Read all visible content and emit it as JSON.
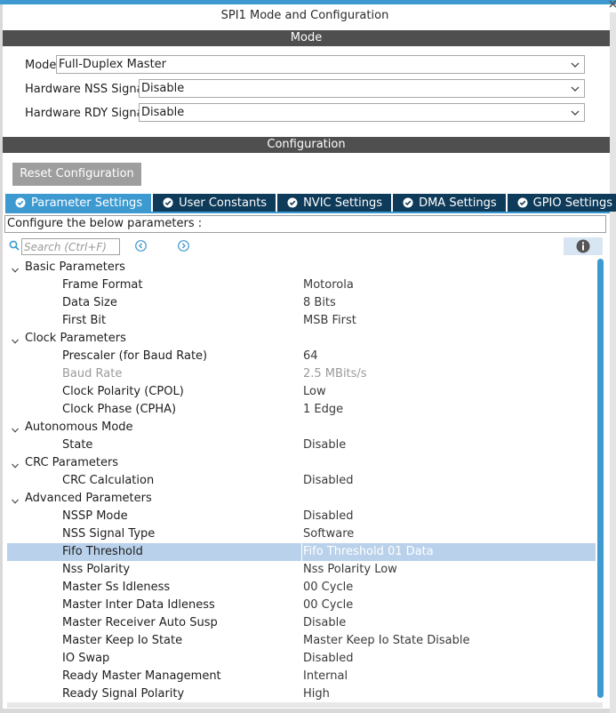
{
  "window": {
    "title": "SPI1 Mode and Configuration"
  },
  "mode_section": {
    "header": "Mode",
    "fields": [
      {
        "label": "Mode",
        "value": "Full-Duplex Master"
      },
      {
        "label": "Hardware NSS Signal",
        "value": "Disable"
      },
      {
        "label": "Hardware RDY Signal",
        "value": "Disable"
      }
    ]
  },
  "config_section": {
    "header": "Configuration",
    "reset_label": "Reset Configuration",
    "tabs": [
      {
        "label": "Parameter Settings",
        "active": true
      },
      {
        "label": "User Constants"
      },
      {
        "label": "NVIC Settings"
      },
      {
        "label": "DMA Settings"
      },
      {
        "label": "GPIO Settings"
      }
    ],
    "hint": "Configure the below parameters :",
    "search_placeholder": "Search (Ctrl+F)"
  },
  "tree": [
    {
      "group": "Basic Parameters",
      "params": [
        {
          "name": "Frame Format",
          "value": "Motorola"
        },
        {
          "name": "Data Size",
          "value": "8 Bits"
        },
        {
          "name": "First Bit",
          "value": "MSB First"
        }
      ]
    },
    {
      "group": "Clock Parameters",
      "params": [
        {
          "name": "Prescaler (for Baud Rate)",
          "value": "64"
        },
        {
          "name": "Baud Rate",
          "value": "2.5 MBits/s",
          "disabled": true
        },
        {
          "name": "Clock Polarity (CPOL)",
          "value": "Low"
        },
        {
          "name": "Clock Phase (CPHA)",
          "value": "1 Edge"
        }
      ]
    },
    {
      "group": "Autonomous Mode",
      "params": [
        {
          "name": "State",
          "value": "Disable"
        }
      ]
    },
    {
      "group": "CRC Parameters",
      "params": [
        {
          "name": "CRC Calculation",
          "value": "Disabled"
        }
      ]
    },
    {
      "group": "Advanced Parameters",
      "params": [
        {
          "name": "NSSP Mode",
          "value": "Disabled"
        },
        {
          "name": "NSS Signal Type",
          "value": "Software"
        },
        {
          "name": "Fifo Threshold",
          "value": "Fifo Threshold 01 Data",
          "selected": true
        },
        {
          "name": "Nss Polarity",
          "value": "Nss Polarity Low"
        },
        {
          "name": "Master Ss Idleness",
          "value": "00 Cycle"
        },
        {
          "name": "Master Inter Data Idleness",
          "value": "00 Cycle"
        },
        {
          "name": "Master Receiver Auto Susp",
          "value": "Disable"
        },
        {
          "name": "Master Keep Io State",
          "value": "Master Keep Io State Disable"
        },
        {
          "name": "IO Swap",
          "value": "Disabled"
        },
        {
          "name": "Ready Master Management",
          "value": "Internal"
        },
        {
          "name": "Ready Signal Polarity",
          "value": "High"
        }
      ]
    }
  ],
  "colors": {
    "accent": "#3d9ad1",
    "tab_dark": "#0f3b5a",
    "header_bar": "#4f4f4f",
    "selection": "#b9d1ea"
  }
}
